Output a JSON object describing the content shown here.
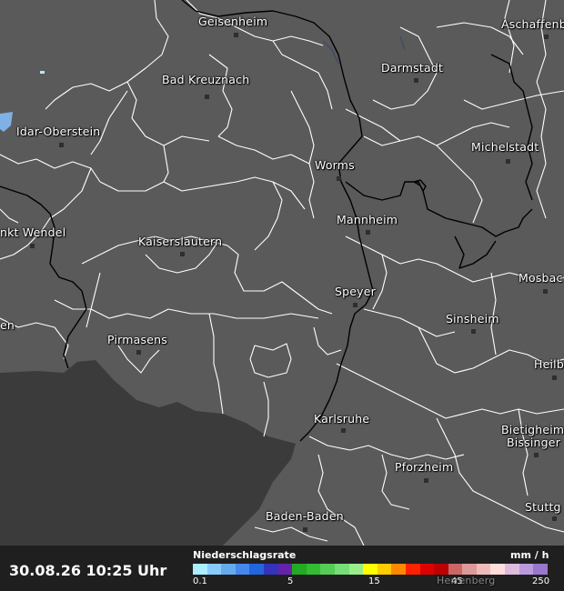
{
  "map": {
    "background_color": "#5a5a5a",
    "foreign_area_color": "#3a3a3a",
    "border_color": "#ffffff",
    "state_border_color": "#000000",
    "cities": [
      {
        "name": "Geisenheim"
      },
      {
        "name": "Aschaffenb"
      },
      {
        "name": "Darmstadt"
      },
      {
        "name": "Bad Kreuznach"
      },
      {
        "name": "Idar-Oberstein"
      },
      {
        "name": "Michelstadt"
      },
      {
        "name": "Worms"
      },
      {
        "name": "Mannheim"
      },
      {
        "name": "nkt Wendel"
      },
      {
        "name": "Kaiserslautern"
      },
      {
        "name": "Mosbac"
      },
      {
        "name": "Speyer"
      },
      {
        "name": "Sinsheim"
      },
      {
        "name": "en"
      },
      {
        "name": "Pirmasens"
      },
      {
        "name": "Heilb"
      },
      {
        "name": "Karlsruhe"
      },
      {
        "name": "Bietigheim"
      },
      {
        "name": "Bissinger"
      },
      {
        "name": "Pforzheim"
      },
      {
        "name": "Stuttg"
      },
      {
        "name": "Baden-Baden"
      },
      {
        "name": "Herrenberg"
      }
    ]
  },
  "footer": {
    "timestamp": "30.08.26 10:25 Uhr",
    "legend_title": "Niederschlagsrate",
    "legend_unit": "mm / h",
    "legend_ticks": [
      "0.1",
      "5",
      "15",
      "45",
      "250"
    ],
    "legend_colors": [
      "#aaeeff",
      "#88ccff",
      "#66aaee",
      "#4488ee",
      "#2266dd",
      "#3333bb",
      "#6622aa",
      "#22aa22",
      "#33bb33",
      "#55cc55",
      "#77dd77",
      "#99ee88",
      "#ffff00",
      "#ffcc00",
      "#ff8800",
      "#ff2200",
      "#dd0000",
      "#bb0000",
      "#cc6666",
      "#dd9999",
      "#eebbbb",
      "#ffdddd",
      "#ddbbdd",
      "#bb99dd",
      "#9977cc"
    ]
  }
}
